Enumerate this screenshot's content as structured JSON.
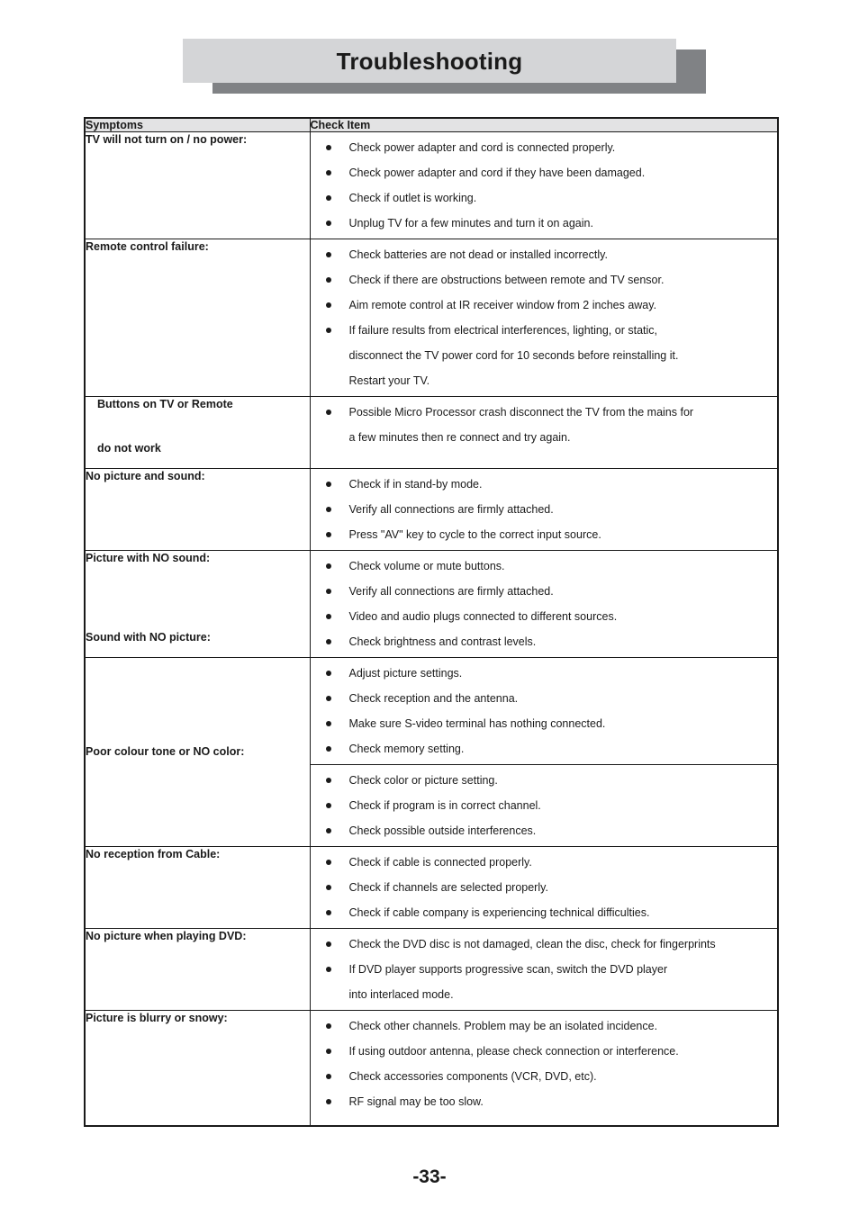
{
  "page": {
    "title": "Troubleshooting",
    "page_number": "-33-",
    "accent_light": "#d4d5d7",
    "accent_shadow": "#808285",
    "header_fill": "#e3e3e4",
    "rule_color": "#1a1a1a"
  },
  "table": {
    "columns": [
      {
        "header": "Symptoms"
      },
      {
        "header": "Check Item"
      }
    ],
    "rows": [
      {
        "symptom": "TV will not turn on / no power:",
        "symptom2": "",
        "checks": [
          {
            "text": "Check power adapter and cord is connected properly.",
            "cont": ""
          },
          {
            "text": "Check power adapter and cord if they have been damaged.",
            "cont": ""
          },
          {
            "text": "Check if outlet is working.",
            "cont": ""
          },
          {
            "text": "Unplug TV for a few minutes and turn it on again.",
            "cont": ""
          }
        ],
        "checks2": []
      },
      {
        "symptom": "Remote control failure:",
        "symptom2": "",
        "checks": [
          {
            "text": "Check batteries are not dead or installed incorrectly.",
            "cont": ""
          },
          {
            "text": "Check if there are obstructions between remote and TV sensor.",
            "cont": ""
          },
          {
            "text": "Aim remote control at IR receiver window from 2 inches away.",
            "cont": ""
          },
          {
            "text": "If failure results from electrical interferences, lighting, or static,",
            "cont": "disconnect the TV power cord for 10 seconds before reinstalling it.",
            "cont2": "Restart your TV."
          }
        ],
        "checks2": []
      },
      {
        "symptom": "Buttons on TV or Remote",
        "symptom2": "do not work",
        "checks": [
          {
            "text": "Possible Micro Processor crash disconnect the TV from the mains for",
            "cont": "a few minutes then re connect and try again."
          }
        ],
        "checks2": []
      },
      {
        "symptom": "No picture and sound:",
        "symptom2": "",
        "checks": [
          {
            "text": "Check if in stand-by mode.",
            "cont": ""
          },
          {
            "text": "Verify all connections are firmly attached.",
            "cont": ""
          },
          {
            "text": "Press \"AV\" key to cycle to the correct input source.",
            "cont": ""
          }
        ],
        "checks2": []
      },
      {
        "symptom": "Picture with NO sound:",
        "symptom2": "Sound with NO picture:",
        "checks": [
          {
            "text": "Check volume or mute buttons.",
            "cont": ""
          },
          {
            "text": "Verify all connections are firmly attached.",
            "cont": ""
          },
          {
            "text": "Video and audio plugs connected to different sources.",
            "cont": ""
          },
          {
            "text": "Check brightness and contrast levels.",
            "cont": ""
          }
        ],
        "checks2": []
      },
      {
        "symptom": "Poor colour tone or NO color:",
        "symptom2": "",
        "checks": [
          {
            "text": "Adjust picture settings.",
            "cont": ""
          },
          {
            "text": "Check reception and the antenna.",
            "cont": ""
          },
          {
            "text": "Make sure S-video terminal has nothing connected.",
            "cont": ""
          },
          {
            "text": "Check memory setting.",
            "cont": ""
          }
        ],
        "checks2": [
          {
            "text": "Check color or picture setting.",
            "cont": ""
          },
          {
            "text": "Check if program is in correct channel.",
            "cont": ""
          },
          {
            "text": "Check possible outside interferences.",
            "cont": ""
          }
        ]
      },
      {
        "symptom": "No reception from Cable:",
        "symptom2": "",
        "checks": [
          {
            "text": "Check if cable is connected properly.",
            "cont": ""
          },
          {
            "text": "Check if channels are selected properly.",
            "cont": ""
          },
          {
            "text": "Check if cable company is experiencing technical difficulties.",
            "cont": ""
          }
        ],
        "checks2": []
      },
      {
        "symptom": "No picture when playing DVD:",
        "symptom2": "",
        "checks": [
          {
            "text": "Check the DVD disc is not damaged, clean the disc, check for fingerprints",
            "cont": ""
          },
          {
            "text": "If DVD player supports progressive scan, switch the DVD player",
            "cont": "into interlaced mode."
          }
        ],
        "checks2": []
      },
      {
        "symptom": "Picture is blurry or snowy:",
        "symptom2": "",
        "checks": [
          {
            "text": "Check other channels. Problem may be an isolated incidence.",
            "cont": ""
          },
          {
            "text": "If using outdoor antenna, please check connection or interference.",
            "cont": ""
          },
          {
            "text": "Check accessories components (VCR, DVD, etc).",
            "cont": ""
          },
          {
            "text": "RF signal may be too slow.",
            "cont": ""
          }
        ],
        "checks2": []
      }
    ]
  }
}
